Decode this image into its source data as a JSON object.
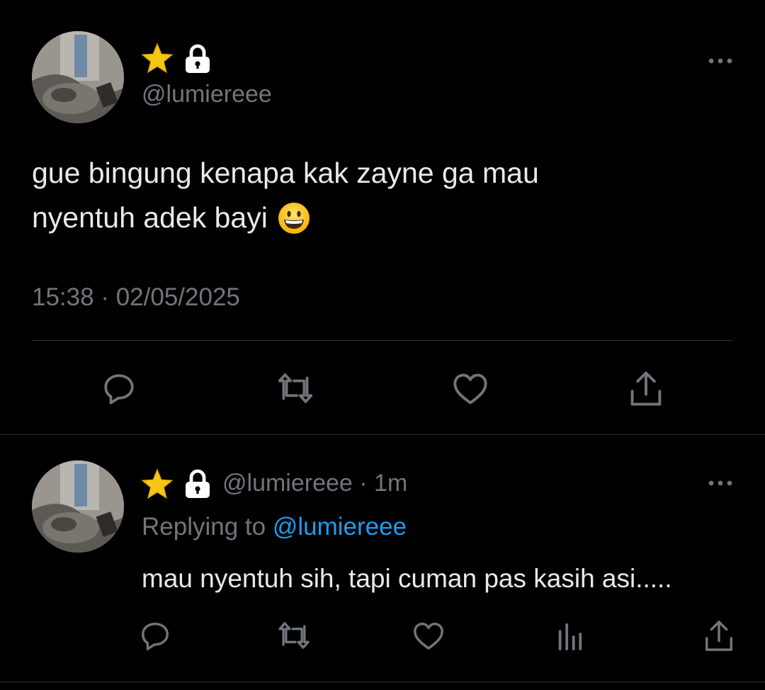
{
  "main_tweet": {
    "handle": "@lumiereee",
    "text_line1": "gue bingung kenapa kak zayne ga mau",
    "text_line2": "nyentuh adek bayi",
    "emoji": "grinning-face",
    "time": "15:38",
    "separator": "·",
    "date": "02/05/2025",
    "badges": [
      "star-icon",
      "lock-icon"
    ]
  },
  "main_actions": [
    "reply-icon",
    "retweet-icon",
    "like-icon",
    "share-icon"
  ],
  "reply_tweet": {
    "handle": "@lumiereee",
    "separator": "·",
    "age": "1m",
    "replying_prefix": "Replying to ",
    "replying_handle": "@lumiereee",
    "text": "mau nyentuh sih, tapi cuman pas kasih asi.....",
    "badges": [
      "star-icon",
      "lock-icon"
    ]
  },
  "reply_actions": [
    "reply-icon",
    "retweet-icon",
    "like-icon",
    "views-icon",
    "share-icon"
  ],
  "colors": {
    "background": "#000000",
    "text": "#e7e9ea",
    "secondary": "#71767b",
    "link": "#1d9bf0",
    "divider": "#2f3336",
    "star": "#f5c518"
  }
}
